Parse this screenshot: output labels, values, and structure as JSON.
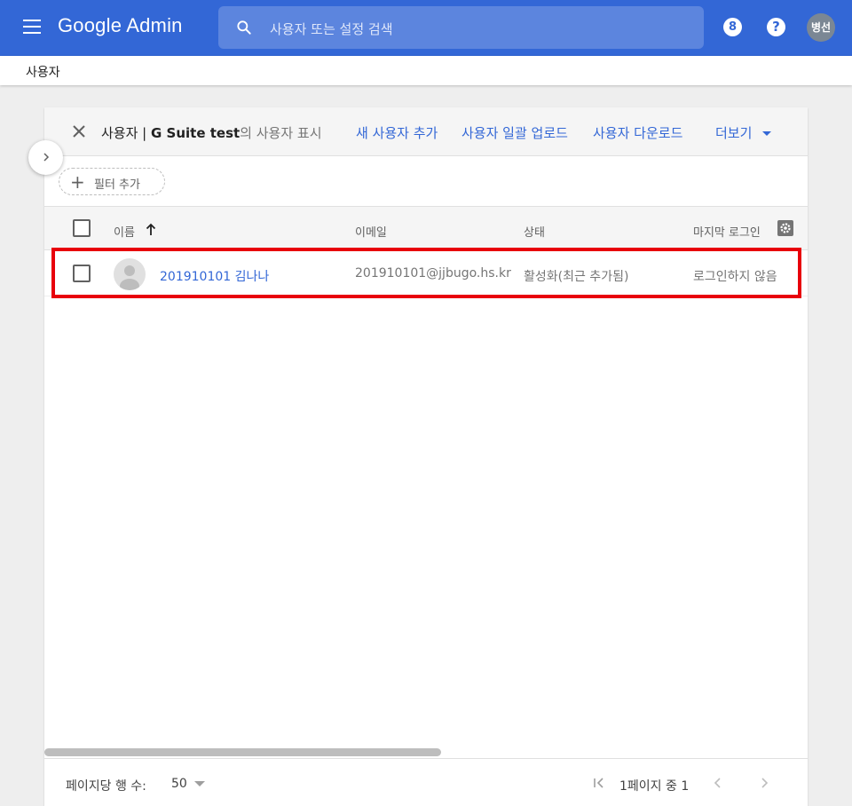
{
  "appbar": {
    "logo": "Google Admin",
    "search_placeholder": "사용자 또는 설정 검색",
    "apps_badge": "8",
    "help_label": "?",
    "avatar_initials": "병선"
  },
  "breadcrumb": {
    "current": "사용자"
  },
  "card": {
    "header": {
      "title_prefix": "사용자 | ",
      "org": "G Suite test",
      "title_suffix": "의 사용자 표시",
      "actions": [
        "새 사용자 추가",
        "사용자 일괄 업로드",
        "사용자 다운로드"
      ],
      "more": "더보기"
    },
    "filter_label": "필터 추가",
    "columns": {
      "name": "이름",
      "email": "이메일",
      "status": "상태",
      "last_login": "마지막 로그인"
    },
    "rows": [
      {
        "name": "201910101 김나나",
        "email": "201910101@jjbugo.hs.kr",
        "status": "활성화(최근 추가됨)",
        "last_login": "로그인하지 않음"
      }
    ],
    "footer": {
      "rows_per_page_label": "페이지당 행 수:",
      "rows_per_page": "50",
      "page_info": "1페이지 중 1"
    }
  },
  "colors": {
    "appbar": "#3367d6",
    "link": "#3367d6",
    "highlight": "#e8000b"
  }
}
